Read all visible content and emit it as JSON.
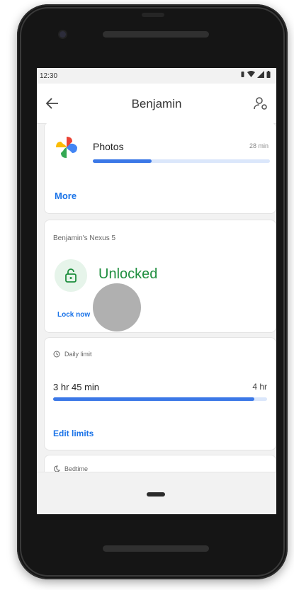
{
  "status_bar": {
    "time": "12:30"
  },
  "app_bar": {
    "title": "Benjamin"
  },
  "app_usage": {
    "app_name": "Photos",
    "time_used": "28 min",
    "usage_progress": 0.33,
    "more_label": "More"
  },
  "device": {
    "name": "Benjamin's Nexus 5",
    "status": "Unlocked",
    "lock_now_label": "Lock now"
  },
  "daily_limit": {
    "heading": "Daily limit",
    "used": "3 hr 45 min",
    "limit": "4 hr",
    "progress": 0.94,
    "edit_label": "Edit limits"
  },
  "bedtime": {
    "heading": "Bedtime"
  },
  "colors": {
    "accent": "#1a73e8",
    "progress": "#3b78e7",
    "unlocked_green": "#1e8e3e"
  }
}
